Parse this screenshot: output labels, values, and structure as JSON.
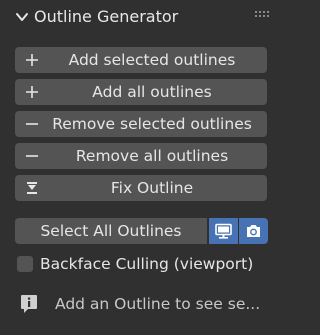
{
  "panel": {
    "title": "Outline Generator",
    "collapse_icon": "chevron-down-icon",
    "grip_icon": "drag-grip-icon"
  },
  "buttons": [
    {
      "label": "Add selected outlines",
      "icon": "plus-icon"
    },
    {
      "label": "Add all outlines",
      "icon": "plus-icon"
    },
    {
      "label": "Remove selected outlines",
      "icon": "minus-icon"
    },
    {
      "label": "Remove all outlines",
      "icon": "minus-icon"
    },
    {
      "label": "Fix Outline",
      "icon": "fix-outline-icon"
    }
  ],
  "select_row": {
    "label": "Select All Outlines",
    "viewport_toggle_icon": "monitor-icon",
    "render_toggle_icon": "camera-icon",
    "viewport_active": true,
    "render_active": true
  },
  "backface": {
    "label": "Backface Culling (viewport)",
    "checked": false
  },
  "info": {
    "icon": "info-icon",
    "text": "Add an Outline to see se..."
  },
  "colors": {
    "background": "#303030",
    "button": "#545454",
    "accent": "#4772b3",
    "text": "#e6e6e6"
  }
}
